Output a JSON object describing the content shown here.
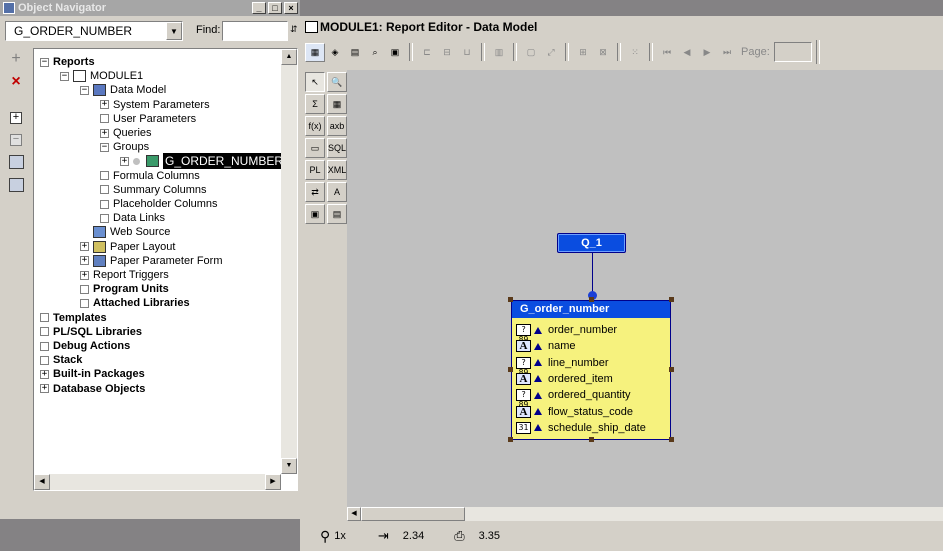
{
  "navigator": {
    "title": "Object Navigator",
    "selector_value": "G_ORDER_NUMBER",
    "find_label": "Find:",
    "find_value": "",
    "side_buttons": [
      "+",
      "×"
    ],
    "tree": [
      {
        "label": "Reports",
        "bold": true,
        "depth": 0,
        "exp": "-",
        "icon": "none"
      },
      {
        "label": "MODULE1",
        "bold": false,
        "depth": 1,
        "exp": "-",
        "icon": "report-icon"
      },
      {
        "label": "Data Model",
        "bold": false,
        "depth": 2,
        "exp": "-",
        "icon": "data-model-icon"
      },
      {
        "label": "System Parameters",
        "bold": false,
        "depth": 3,
        "exp": "+",
        "icon": "none"
      },
      {
        "label": "User Parameters",
        "bold": false,
        "depth": 3,
        "exp": "□",
        "icon": "none"
      },
      {
        "label": "Queries",
        "bold": false,
        "depth": 3,
        "exp": "+",
        "icon": "none"
      },
      {
        "label": "Groups",
        "bold": false,
        "depth": 3,
        "exp": "-",
        "icon": "none"
      },
      {
        "label": "G_ORDER_NUMBER",
        "bold": false,
        "depth": 4,
        "exp": "+",
        "icon": "group-icon",
        "selected": true
      },
      {
        "label": "Formula Columns",
        "bold": false,
        "depth": 3,
        "exp": "□",
        "icon": "none"
      },
      {
        "label": "Summary Columns",
        "bold": false,
        "depth": 3,
        "exp": "□",
        "icon": "none"
      },
      {
        "label": "Placeholder Columns",
        "bold": false,
        "depth": 3,
        "exp": "□",
        "icon": "none"
      },
      {
        "label": "Data Links",
        "bold": false,
        "depth": 3,
        "exp": "□",
        "icon": "none"
      },
      {
        "label": "Web Source",
        "bold": false,
        "depth": 2,
        "exp": "none",
        "icon": "web-source-icon"
      },
      {
        "label": "Paper Layout",
        "bold": false,
        "depth": 2,
        "exp": "+",
        "icon": "paper-layout-icon"
      },
      {
        "label": "Paper Parameter Form",
        "bold": false,
        "depth": 2,
        "exp": "+",
        "icon": "parameter-form-icon"
      },
      {
        "label": "Report Triggers",
        "bold": false,
        "depth": 2,
        "exp": "+",
        "icon": "none"
      },
      {
        "label": "Program Units",
        "bold": true,
        "depth": 2,
        "exp": "□",
        "icon": "none"
      },
      {
        "label": "Attached Libraries",
        "bold": true,
        "depth": 2,
        "exp": "□",
        "icon": "none"
      },
      {
        "label": "Templates",
        "bold": true,
        "depth": 0,
        "exp": "□",
        "icon": "none"
      },
      {
        "label": "PL/SQL Libraries",
        "bold": true,
        "depth": 0,
        "exp": "□",
        "icon": "none"
      },
      {
        "label": "Debug Actions",
        "bold": true,
        "depth": 0,
        "exp": "□",
        "icon": "none"
      },
      {
        "label": "Stack",
        "bold": true,
        "depth": 0,
        "exp": "□",
        "icon": "none"
      },
      {
        "label": "Built-in Packages",
        "bold": true,
        "depth": 0,
        "exp": "+",
        "icon": "none"
      },
      {
        "label": "Database Objects",
        "bold": true,
        "depth": 0,
        "exp": "+",
        "icon": "none"
      }
    ]
  },
  "editor": {
    "title": "MODULE1: Report Editor - Data Model",
    "page_label": "Page:",
    "page_value": "",
    "query_name": "Q_1",
    "group_name": "G_order_number",
    "columns": [
      {
        "name": "order_number",
        "type": "?89"
      },
      {
        "name": "name",
        "type": "A"
      },
      {
        "name": "line_number",
        "type": "?89"
      },
      {
        "name": "ordered_item",
        "type": "A"
      },
      {
        "name": "ordered_quantity",
        "type": "?89"
      },
      {
        "name": "flow_status_code",
        "type": "A"
      },
      {
        "name": "schedule_ship_date",
        "type": "31"
      }
    ],
    "palette": [
      "↖",
      "🔍",
      "Σ",
      "▦",
      "f(x)",
      "axb",
      "▭",
      "SQL",
      "PL",
      "XML",
      "⇄",
      "A",
      "▣",
      "▤"
    ],
    "status": {
      "zoom": "1x",
      "x": "2.34",
      "y": "3.35"
    }
  }
}
